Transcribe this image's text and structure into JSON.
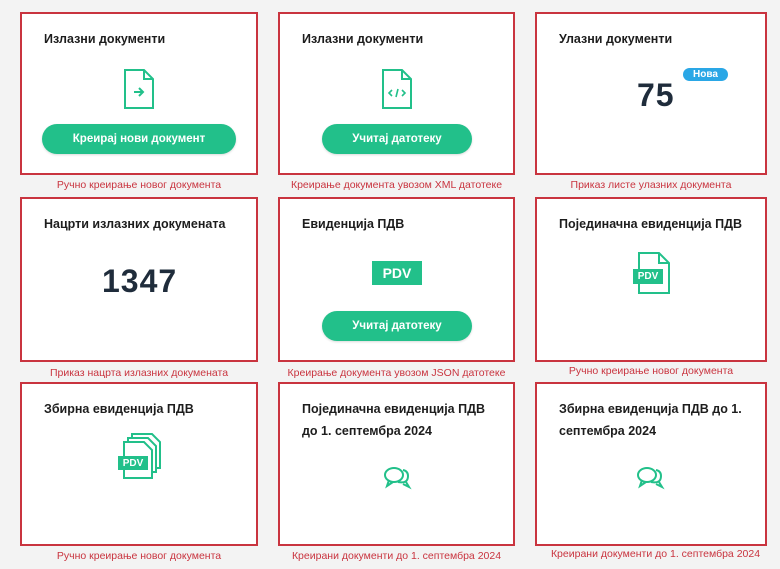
{
  "cards": [
    {
      "title": "Излазни документи",
      "button": "Креирај нови документ",
      "caption": "Ручно креирање новог документа",
      "icon": "outgoing-document-icon"
    },
    {
      "title": "Излазни документи",
      "button": "Учитај датотеку",
      "caption": "Креирање документа увозом XML датотеке",
      "icon": "xml-document-icon"
    },
    {
      "title": "Улазни документи",
      "count": "75",
      "badge": "Нова",
      "caption": "Приказ листе улазних документа"
    },
    {
      "title": "Нацрти излазних докумената",
      "count": "1347",
      "caption": "Приказ нацрта излазних докумената"
    },
    {
      "title": "Евиденција ПДВ",
      "pdv_label": "PDV",
      "button": "Учитај датотеку",
      "caption": "Креирање документа увозом JSON датотеке"
    },
    {
      "title": "Појединачна евиденција ПДВ",
      "pdv_label": "PDV",
      "caption": "Ручно креирање новог документа",
      "icon": "pdv-document-icon"
    },
    {
      "title": "Збирна евиденција ПДВ",
      "pdv_label": "PDV",
      "caption": "Ручно креирање новог документа",
      "icon": "pdv-documents-stack-icon"
    },
    {
      "title": "Појединачна евиденција ПДВ до 1. септембра 2024",
      "caption": "Креирани документи до 1. септембра 2024",
      "icon": "chat-bubbles-icon"
    },
    {
      "title": "Збирна евиденција ПДВ до 1. септембра 2024",
      "caption": "Креирани документи до 1. септембра 2024",
      "icon": "chat-bubbles-icon"
    }
  ],
  "colors": {
    "accent": "#22c08a",
    "highlight_border": "#c9343f",
    "badge": "#2aa7e6"
  }
}
